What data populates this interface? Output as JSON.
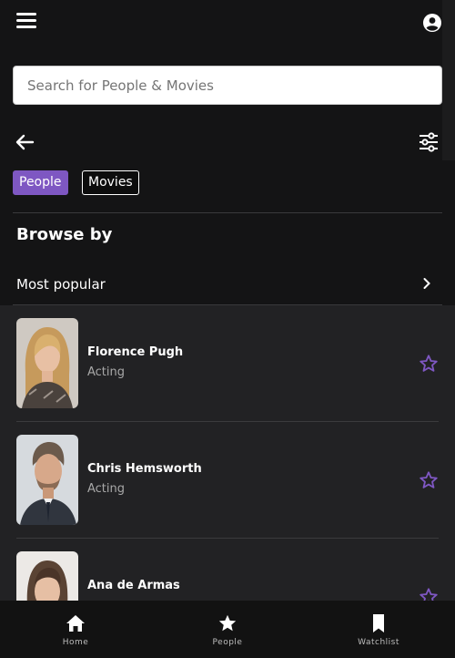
{
  "header": {
    "menu_icon": "hamburger-menu-icon",
    "account_icon": "account-circle-icon"
  },
  "search": {
    "placeholder": "Search for People & Movies",
    "value": ""
  },
  "toolbar": {
    "back_icon": "arrow-left-icon",
    "filter_icon": "sliders-icon"
  },
  "tabs": [
    {
      "label": "People",
      "selected": true
    },
    {
      "label": "Movies",
      "selected": false
    }
  ],
  "browse": {
    "title": "Browse by",
    "category": "Most popular"
  },
  "people": [
    {
      "name": "Florence Pugh",
      "department": "Acting"
    },
    {
      "name": "Chris Hemsworth",
      "department": "Acting"
    },
    {
      "name": "Ana de Armas",
      "department": ""
    }
  ],
  "bottom_nav": [
    {
      "label": "Home",
      "icon": "home-icon"
    },
    {
      "label": "People",
      "icon": "star-icon"
    },
    {
      "label": "Watchlist",
      "icon": "bookmark-icon"
    }
  ],
  "colors": {
    "accent": "#7e57c2",
    "background": "#141415",
    "list_background": "#222224"
  }
}
